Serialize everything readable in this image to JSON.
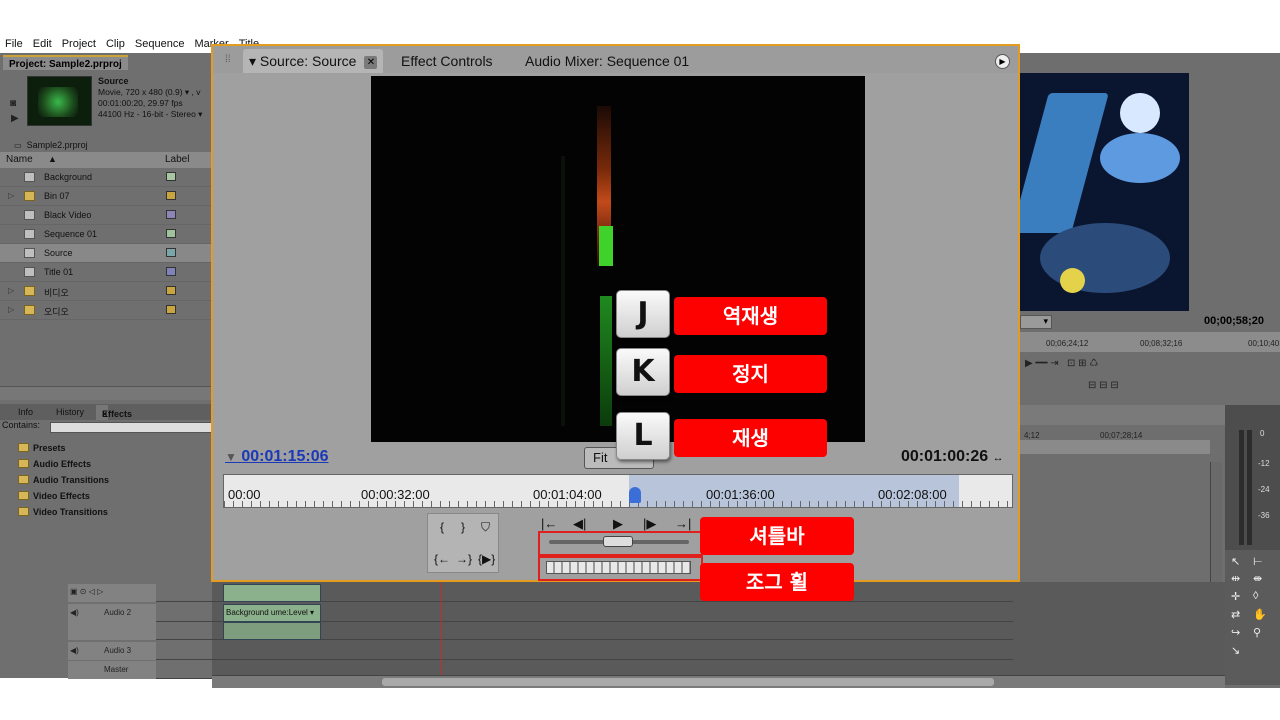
{
  "menu": [
    "File",
    "Edit",
    "Project",
    "Clip",
    "Sequence",
    "Marker",
    "Title"
  ],
  "project": {
    "tab": "Project: Sample2.prproj",
    "source_name": "Source",
    "source_line1": "Movie, 720 x 480 (0.9)  ▾ , v",
    "source_line2": "00:01:00:20, 29.97 fps",
    "source_line3": "44100 Hz - 16-bit - Stereo  ▾",
    "file": "Sample2.prproj",
    "col_name": "Name",
    "col_label": "Label",
    "items": [
      {
        "name": "Background",
        "icon": "audio-icon",
        "color": "#a8c4a0"
      },
      {
        "name": "Bin 07",
        "icon": "folder-icon",
        "color": "#c9a53f"
      },
      {
        "name": "Black Video",
        "icon": "video-icon",
        "color": "#8b86b6"
      },
      {
        "name": "Sequence 01",
        "icon": "sequence-icon",
        "color": "#9ec29c"
      },
      {
        "name": "Source",
        "icon": "clip-icon",
        "color": "#7aa6a9"
      },
      {
        "name": "Title 01",
        "icon": "title-icon",
        "color": "#7f83b8"
      },
      {
        "name": "비디오",
        "icon": "folder-icon",
        "color": "#c9a53f"
      },
      {
        "name": "오디오",
        "icon": "folder-icon",
        "color": "#c9a53f"
      }
    ]
  },
  "effects": {
    "tabs": [
      "Info",
      "History",
      "Effects"
    ],
    "contains": "Contains:",
    "items": [
      "Presets",
      "Audio Effects",
      "Audio Transitions",
      "Video Effects",
      "Video Transitions"
    ]
  },
  "source": {
    "tabs": [
      "Source: Source",
      "Effect Controls",
      "Audio Mixer: Sequence 01"
    ],
    "timecode_current": "00:01:15:06",
    "timecode_duration": "00:01:00:26",
    "fit": "Fit",
    "ruler": [
      "00:00",
      "00:00:32:00",
      "00:01:04:00",
      "00:01:36:00",
      "00:02:08:00"
    ],
    "playhead_fraction": 0.52
  },
  "program": {
    "timecode": "00;00;58;20",
    "ruler": [
      "00;06;24;12",
      "00;08;32;16",
      "00;10;40;"
    ],
    "tl_ruler": [
      "4;12",
      "00;07;28;14"
    ],
    "meter_labels": [
      "0",
      "-12",
      "-24",
      "-36"
    ]
  },
  "timeline": {
    "tracks": [
      "Audio 2",
      "Audio 3",
      "Master"
    ],
    "clip_label": "Background  ume:Level ▾"
  },
  "annotations": {
    "keys": [
      {
        "key": "J",
        "label": "역재생"
      },
      {
        "key": "K",
        "label": "정지"
      },
      {
        "key": "L",
        "label": "재생"
      }
    ],
    "shuttle": "셔틀바",
    "jog": "조그 휠"
  }
}
